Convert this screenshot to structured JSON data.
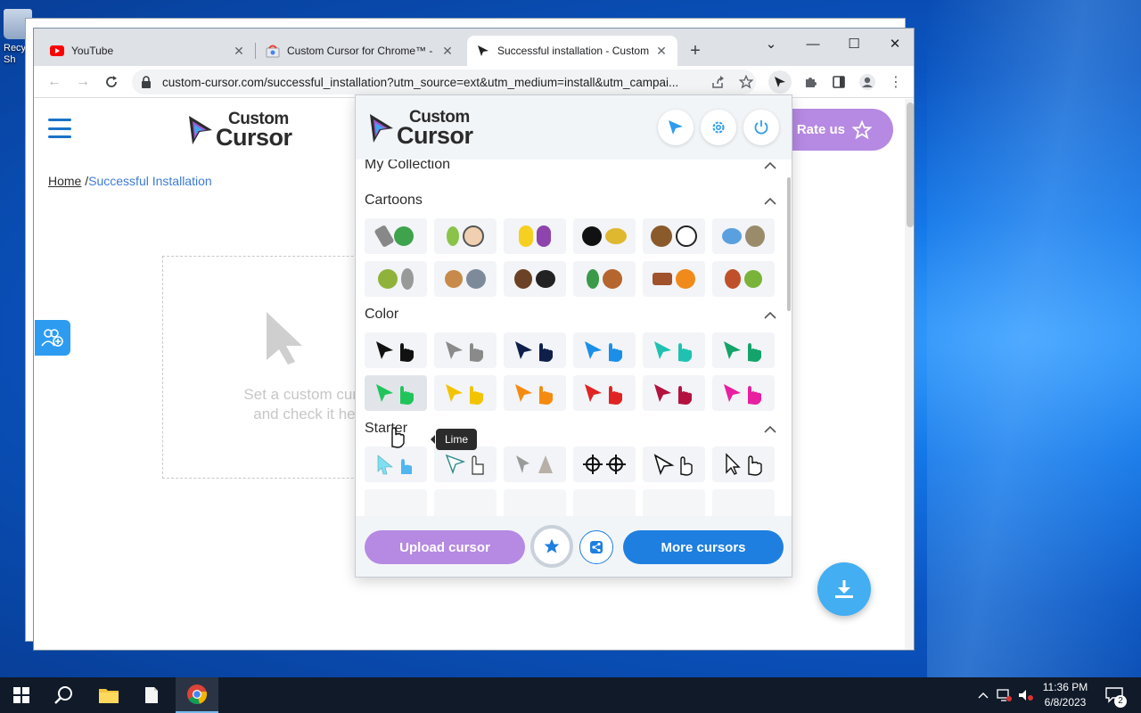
{
  "desktop": {
    "icon_label_1": "Recy",
    "icon_label_2": "Sh"
  },
  "browser": {
    "tabs": [
      {
        "title": "YouTube",
        "active": false
      },
      {
        "title": "Custom Cursor for Chrome™ - C",
        "active": false
      },
      {
        "title": "Successful installation - Custom",
        "active": true
      }
    ],
    "new_tab_label": "+",
    "url": "custom-cursor.com/successful_installation?utm_source=ext&utm_medium=install&utm_campai..."
  },
  "site": {
    "logo_line1": "Custom",
    "logo_line2": "Cursor",
    "rate_label": "Rate us",
    "breadcrumb_home": "Home",
    "breadcrumb_sep": "/",
    "breadcrumb_current": "Successful Installation",
    "dropzone_line1": "Set a custom cursor",
    "dropzone_line2": "and check it here"
  },
  "popup": {
    "logo_line1": "Custom",
    "logo_line2": "Cursor",
    "sections": {
      "collection": "My Collection",
      "cartoons": "Cartoons",
      "color": "Color",
      "starter": "Starter"
    },
    "color_pairs": [
      "#111111",
      "#8a8a8a",
      "#0f1f4a",
      "#1b8fe8",
      "#1fc2b0",
      "#14a36a",
      "#21c45a",
      "#f2c400",
      "#f58a10",
      "#e02424",
      "#b3123f",
      "#e81fa0"
    ],
    "tooltip": "Lime",
    "upload_label": "Upload cursor",
    "more_label": "More cursors"
  },
  "taskbar": {
    "time": "11:36 PM",
    "date": "6/8/2023",
    "notifications": "2"
  }
}
